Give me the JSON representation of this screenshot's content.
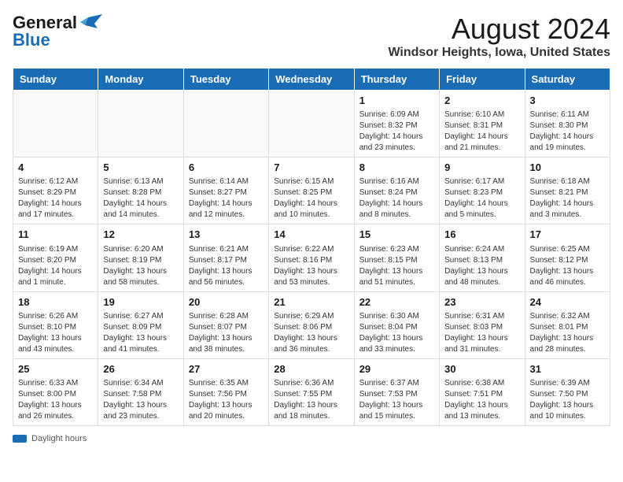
{
  "logo": {
    "line1": "General",
    "line2": "Blue"
  },
  "title": "August 2024",
  "subtitle": "Windsor Heights, Iowa, United States",
  "days_header": [
    "Sunday",
    "Monday",
    "Tuesday",
    "Wednesday",
    "Thursday",
    "Friday",
    "Saturday"
  ],
  "weeks": [
    [
      {
        "day": "",
        "info": ""
      },
      {
        "day": "",
        "info": ""
      },
      {
        "day": "",
        "info": ""
      },
      {
        "day": "",
        "info": ""
      },
      {
        "day": "1",
        "info": "Sunrise: 6:09 AM\nSunset: 8:32 PM\nDaylight: 14 hours\nand 23 minutes."
      },
      {
        "day": "2",
        "info": "Sunrise: 6:10 AM\nSunset: 8:31 PM\nDaylight: 14 hours\nand 21 minutes."
      },
      {
        "day": "3",
        "info": "Sunrise: 6:11 AM\nSunset: 8:30 PM\nDaylight: 14 hours\nand 19 minutes."
      }
    ],
    [
      {
        "day": "4",
        "info": "Sunrise: 6:12 AM\nSunset: 8:29 PM\nDaylight: 14 hours\nand 17 minutes."
      },
      {
        "day": "5",
        "info": "Sunrise: 6:13 AM\nSunset: 8:28 PM\nDaylight: 14 hours\nand 14 minutes."
      },
      {
        "day": "6",
        "info": "Sunrise: 6:14 AM\nSunset: 8:27 PM\nDaylight: 14 hours\nand 12 minutes."
      },
      {
        "day": "7",
        "info": "Sunrise: 6:15 AM\nSunset: 8:25 PM\nDaylight: 14 hours\nand 10 minutes."
      },
      {
        "day": "8",
        "info": "Sunrise: 6:16 AM\nSunset: 8:24 PM\nDaylight: 14 hours\nand 8 minutes."
      },
      {
        "day": "9",
        "info": "Sunrise: 6:17 AM\nSunset: 8:23 PM\nDaylight: 14 hours\nand 5 minutes."
      },
      {
        "day": "10",
        "info": "Sunrise: 6:18 AM\nSunset: 8:21 PM\nDaylight: 14 hours\nand 3 minutes."
      }
    ],
    [
      {
        "day": "11",
        "info": "Sunrise: 6:19 AM\nSunset: 8:20 PM\nDaylight: 14 hours\nand 1 minute."
      },
      {
        "day": "12",
        "info": "Sunrise: 6:20 AM\nSunset: 8:19 PM\nDaylight: 13 hours\nand 58 minutes."
      },
      {
        "day": "13",
        "info": "Sunrise: 6:21 AM\nSunset: 8:17 PM\nDaylight: 13 hours\nand 56 minutes."
      },
      {
        "day": "14",
        "info": "Sunrise: 6:22 AM\nSunset: 8:16 PM\nDaylight: 13 hours\nand 53 minutes."
      },
      {
        "day": "15",
        "info": "Sunrise: 6:23 AM\nSunset: 8:15 PM\nDaylight: 13 hours\nand 51 minutes."
      },
      {
        "day": "16",
        "info": "Sunrise: 6:24 AM\nSunset: 8:13 PM\nDaylight: 13 hours\nand 48 minutes."
      },
      {
        "day": "17",
        "info": "Sunrise: 6:25 AM\nSunset: 8:12 PM\nDaylight: 13 hours\nand 46 minutes."
      }
    ],
    [
      {
        "day": "18",
        "info": "Sunrise: 6:26 AM\nSunset: 8:10 PM\nDaylight: 13 hours\nand 43 minutes."
      },
      {
        "day": "19",
        "info": "Sunrise: 6:27 AM\nSunset: 8:09 PM\nDaylight: 13 hours\nand 41 minutes."
      },
      {
        "day": "20",
        "info": "Sunrise: 6:28 AM\nSunset: 8:07 PM\nDaylight: 13 hours\nand 38 minutes."
      },
      {
        "day": "21",
        "info": "Sunrise: 6:29 AM\nSunset: 8:06 PM\nDaylight: 13 hours\nand 36 minutes."
      },
      {
        "day": "22",
        "info": "Sunrise: 6:30 AM\nSunset: 8:04 PM\nDaylight: 13 hours\nand 33 minutes."
      },
      {
        "day": "23",
        "info": "Sunrise: 6:31 AM\nSunset: 8:03 PM\nDaylight: 13 hours\nand 31 minutes."
      },
      {
        "day": "24",
        "info": "Sunrise: 6:32 AM\nSunset: 8:01 PM\nDaylight: 13 hours\nand 28 minutes."
      }
    ],
    [
      {
        "day": "25",
        "info": "Sunrise: 6:33 AM\nSunset: 8:00 PM\nDaylight: 13 hours\nand 26 minutes."
      },
      {
        "day": "26",
        "info": "Sunrise: 6:34 AM\nSunset: 7:58 PM\nDaylight: 13 hours\nand 23 minutes."
      },
      {
        "day": "27",
        "info": "Sunrise: 6:35 AM\nSunset: 7:56 PM\nDaylight: 13 hours\nand 20 minutes."
      },
      {
        "day": "28",
        "info": "Sunrise: 6:36 AM\nSunset: 7:55 PM\nDaylight: 13 hours\nand 18 minutes."
      },
      {
        "day": "29",
        "info": "Sunrise: 6:37 AM\nSunset: 7:53 PM\nDaylight: 13 hours\nand 15 minutes."
      },
      {
        "day": "30",
        "info": "Sunrise: 6:38 AM\nSunset: 7:51 PM\nDaylight: 13 hours\nand 13 minutes."
      },
      {
        "day": "31",
        "info": "Sunrise: 6:39 AM\nSunset: 7:50 PM\nDaylight: 13 hours\nand 10 minutes."
      }
    ]
  ],
  "legend": {
    "icon": "bar",
    "label": "Daylight hours"
  }
}
